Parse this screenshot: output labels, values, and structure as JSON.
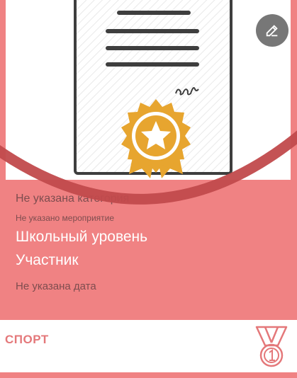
{
  "card": {
    "category": "Не указана категория",
    "event": "Не указано мероприятие",
    "level": "Школьный уровень",
    "role": "Участник",
    "date": "Не указана дата"
  },
  "footer": {
    "title": "СПОРТ"
  },
  "icons": {
    "edit": "pencil-icon",
    "certificate": "certificate-icon",
    "medal": "medal-icon"
  },
  "colors": {
    "card_background": "#f08283",
    "edit_button": "#777777",
    "footer_title": "#e4787a",
    "seal": "#e7a52f",
    "swoosh": "#c14a4c"
  }
}
